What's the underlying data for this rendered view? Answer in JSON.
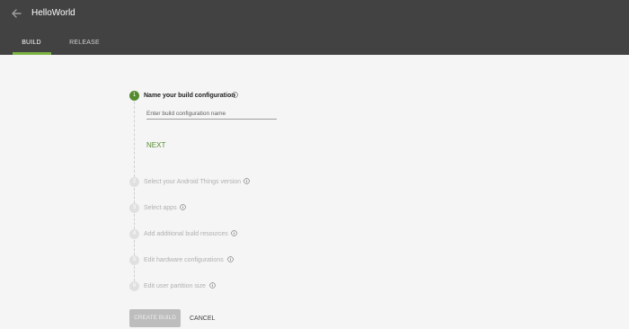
{
  "header": {
    "title": "HelloWorld",
    "tabs": [
      {
        "label": "BUILD",
        "active": true
      },
      {
        "label": "RELEASE",
        "active": false
      }
    ]
  },
  "colors": {
    "topbar": "#424242",
    "accent": "#558b2f",
    "tab_indicator": "#7cb342",
    "background": "#f5f5f5"
  },
  "stepper": {
    "steps": [
      {
        "number": "1",
        "label": "Name your build configuration",
        "active": true
      },
      {
        "number": "2",
        "label": "Select your Android Things version",
        "active": false
      },
      {
        "number": "3",
        "label": "Select apps",
        "active": false
      },
      {
        "number": "4",
        "label": "Add additional build resources",
        "active": false
      },
      {
        "number": "5",
        "label": "Edit hardware configurations",
        "active": false
      },
      {
        "number": "6",
        "label": "Edit user partition size",
        "active": false
      }
    ],
    "name_field": {
      "placeholder": "Enter build configuration name",
      "value": ""
    },
    "next_label": "NEXT"
  },
  "footer": {
    "create_label": "CREATE BUILD",
    "cancel_label": "CANCEL"
  },
  "icons": {
    "back": "arrow-back-icon",
    "info": "info-icon"
  }
}
